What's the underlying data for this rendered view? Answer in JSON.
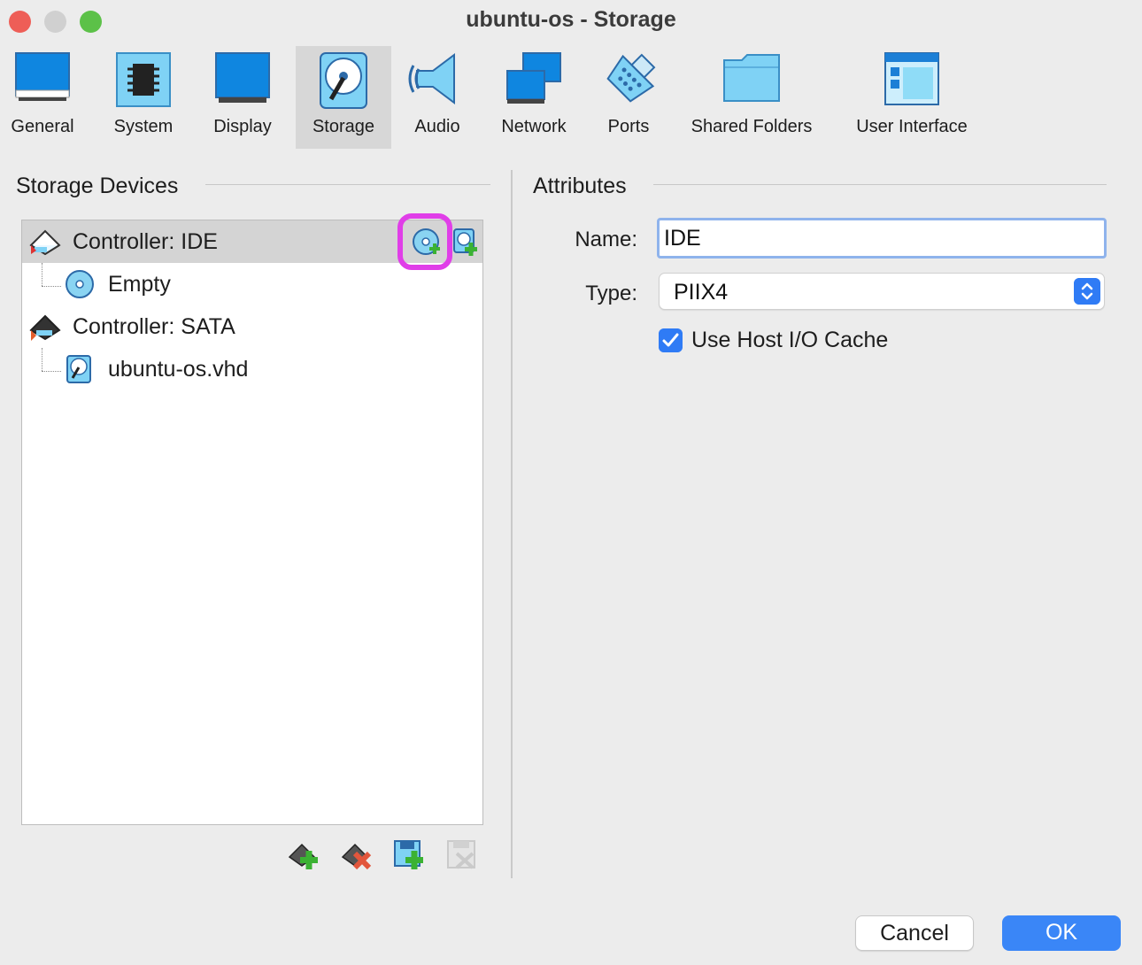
{
  "window": {
    "title": "ubuntu-os - Storage",
    "controls": [
      "close",
      "minimize",
      "zoom"
    ]
  },
  "toolbar": {
    "items": [
      {
        "label": "General",
        "icon": "monitor-icon"
      },
      {
        "label": "System",
        "icon": "chip-icon"
      },
      {
        "label": "Display",
        "icon": "display-icon"
      },
      {
        "label": "Storage",
        "icon": "harddisk-icon",
        "active": true
      },
      {
        "label": "Audio",
        "icon": "speaker-icon"
      },
      {
        "label": "Network",
        "icon": "network-icon"
      },
      {
        "label": "Ports",
        "icon": "serial-port-icon"
      },
      {
        "label": "Shared Folders",
        "icon": "folder-icon"
      },
      {
        "label": "User Interface",
        "icon": "window-layout-icon"
      }
    ]
  },
  "storage_devices": {
    "title": "Storage Devices",
    "tree": [
      {
        "label": "Controller: IDE",
        "type": "controller",
        "selected": true
      },
      {
        "label": "Empty",
        "type": "optical-drive"
      },
      {
        "label": "Controller: SATA",
        "type": "controller"
      },
      {
        "label": "ubuntu-os.vhd",
        "type": "hard-disk"
      }
    ],
    "row_actions": [
      "add-optical-drive-icon",
      "add-hard-disk-icon"
    ],
    "bottom_actions": [
      "add-controller-icon",
      "remove-controller-icon",
      "add-attachment-icon",
      "remove-attachment-icon"
    ]
  },
  "attributes": {
    "title": "Attributes",
    "name_label": "Name:",
    "name_value": "IDE",
    "type_label": "Type:",
    "type_value": "PIIX4",
    "cache_label": "Use Host I/O Cache",
    "cache_checked": true
  },
  "buttons": {
    "cancel": "Cancel",
    "ok": "OK"
  },
  "colors": {
    "accent": "#2f7bf5",
    "highlight_ring": "#e03ee8",
    "close": "#ee5e57",
    "minimize": "#d0d0d0",
    "zoom": "#5cc148"
  }
}
